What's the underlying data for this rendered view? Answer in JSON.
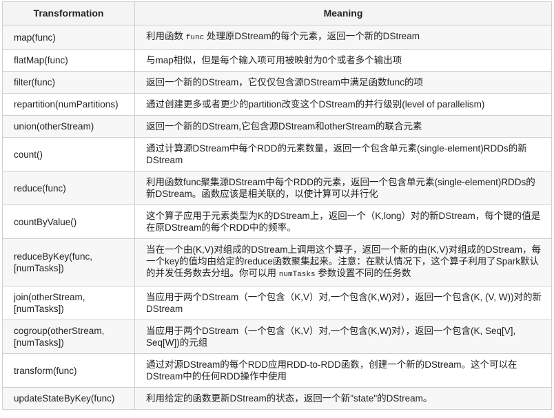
{
  "headers": {
    "transformation": "Transformation",
    "meaning": "Meaning"
  },
  "rows": [
    {
      "name": "map(func)",
      "meaning_pre": "利用函数 ",
      "meaning_code": "func",
      "meaning_post": " 处理原DStream的每个元素，返回一个新的DStream"
    },
    {
      "name": "flatMap(func)",
      "meaning": "与map相似，但是每个输入项可用被映射为0个或者多个输出项"
    },
    {
      "name": "filter(func)",
      "meaning": "返回一个新的DStream，它仅仅包含源DStream中满足函数func的项"
    },
    {
      "name": "repartition(numPartitions)",
      "meaning": "通过创建更多或者更少的partition改变这个DStream的并行级别(level of parallelism)"
    },
    {
      "name": "union(otherStream)",
      "meaning": "返回一个新的DStream,它包含源DStream和otherStream的联合元素"
    },
    {
      "name": "count()",
      "meaning": "通过计算源DStream中每个RDD的元素数量，返回一个包含单元素(single-element)RDDs的新DStream"
    },
    {
      "name": "reduce(func)",
      "meaning": "利用函数func聚集源DStream中每个RDD的元素，返回一个包含单元素(single-element)RDDs的新DStream。函数应该是相关联的，以使计算可以并行化"
    },
    {
      "name": "countByValue()",
      "meaning": "这个算子应用于元素类型为K的DStream上，返回一个（K,long）对的新DStream，每个键的值是在原DStream的每个RDD中的频率。"
    },
    {
      "name": "reduceByKey(func, [numTasks])",
      "meaning_pre": "当在一个由(K,V)对组成的DStream上调用这个算子，返回一个新的由(K,V)对组成的DStream，每一个key的值均由给定的reduce函数聚集起来。注意：在默认情况下，这个算子利用了Spark默认的并发任务数去分组。你可以用 ",
      "meaning_code": "numTasks",
      "meaning_post": " 参数设置不同的任务数"
    },
    {
      "name": "join(otherStream, [numTasks])",
      "meaning": "当应用于两个DStream（一个包含（K,V）对,一个包含(K,W)对），返回一个包含(K, (V, W))对的新DStream"
    },
    {
      "name": "cogroup(otherStream, [numTasks])",
      "meaning": "当应用于两个DStream（一个包含（K,V）对,一个包含(K,W)对），返回一个包含(K, Seq[V], Seq[W])的元组"
    },
    {
      "name": "transform(func)",
      "meaning": "通过对源DStream的每个RDD应用RDD-to-RDD函数，创建一个新的DStream。这个可以在DStream中的任何RDD操作中使用"
    },
    {
      "name": "updateStateByKey(func)",
      "meaning": "利用给定的函数更新DStream的状态，返回一个新\"state\"的DStream。"
    }
  ]
}
